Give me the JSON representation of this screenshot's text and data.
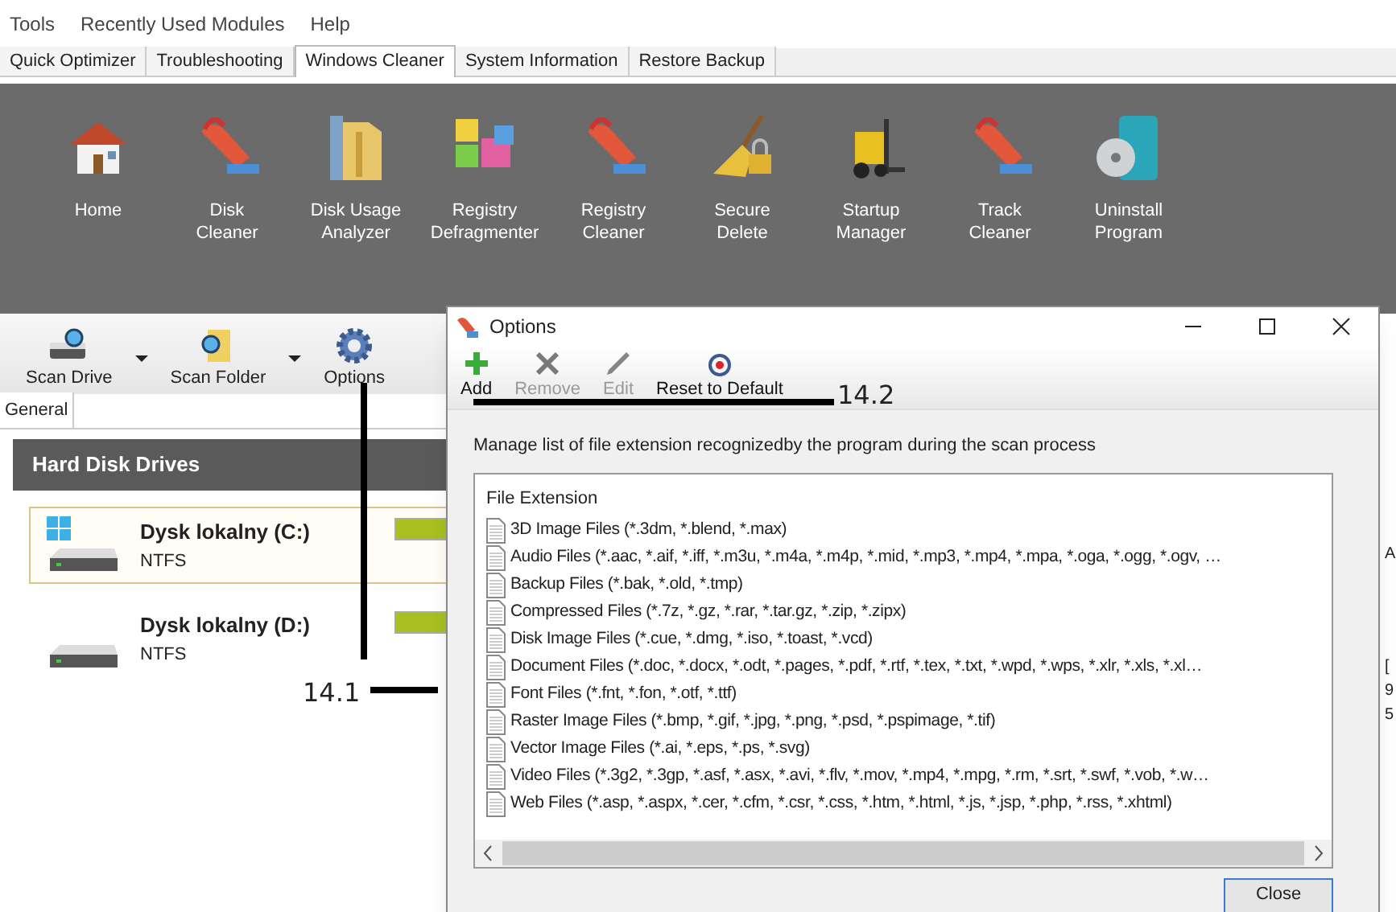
{
  "menu": [
    "Tools",
    "Recently Used Modules",
    "Help"
  ],
  "tabs": [
    {
      "label": "Quick Optimizer",
      "selected": false
    },
    {
      "label": "Troubleshooting",
      "selected": false
    },
    {
      "label": "Windows Cleaner",
      "selected": true
    },
    {
      "label": "System Information",
      "selected": false
    },
    {
      "label": "Restore Backup",
      "selected": false
    }
  ],
  "modules": [
    {
      "label": "Home",
      "kind": "house"
    },
    {
      "label": "Disk\nCleaner",
      "kind": "vacuum"
    },
    {
      "label": "Disk Usage\nAnalyzer",
      "kind": "folder"
    },
    {
      "label": "Registry\nDefragmenter",
      "kind": "blocks"
    },
    {
      "label": "Registry\nCleaner",
      "kind": "vacuum"
    },
    {
      "label": "Secure\nDelete",
      "kind": "broom"
    },
    {
      "label": "Startup\nManager",
      "kind": "forklift"
    },
    {
      "label": "Track\nCleaner",
      "kind": "vacuum"
    },
    {
      "label": "Uninstall\nProgram",
      "kind": "disc"
    }
  ],
  "toolbar": [
    {
      "label": "Scan Drive",
      "kind": "drive",
      "dropdown": true
    },
    {
      "label": "Scan Folder",
      "kind": "folder",
      "dropdown": true
    },
    {
      "label": "Options",
      "kind": "gear",
      "dropdown": false
    }
  ],
  "panel_tab": "General",
  "section_title": "Hard Disk Drives",
  "drives": [
    {
      "name": "Dysk lokalny (C:)",
      "fs": "NTFS",
      "system": true,
      "selected": true
    },
    {
      "name": "Dysk lokalny (D:)",
      "fs": "NTFS",
      "system": false,
      "selected": false
    }
  ],
  "background_fragments": [
    "A",
    "[",
    "9",
    "5"
  ],
  "dialog": {
    "title": "Options",
    "toolbar": [
      {
        "label": "Add",
        "kind": "add",
        "disabled": false
      },
      {
        "label": "Remove",
        "kind": "remove",
        "disabled": true
      },
      {
        "label": "Edit",
        "kind": "edit",
        "disabled": true
      },
      {
        "label": "Reset to Default",
        "kind": "reset",
        "disabled": false
      }
    ],
    "description": "Manage list of file extension recognizedby the program during the scan process",
    "list_header": "File Extension",
    "items": [
      "3D Image Files (*.3dm, *.blend, *.max)",
      "Audio Files (*.aac, *.aif, *.iff, *.m3u, *.m4a, *.m4p, *.mid, *.mp3, *.mp4, *.mpa, *.oga, *.ogg, *.ogv, …",
      "Backup Files (*.bak, *.old, *.tmp)",
      "Compressed Files (*.7z, *.gz, *.rar, *.tar.gz, *.zip, *.zipx)",
      "Disk Image Files (*.cue, *.dmg, *.iso, *.toast, *.vcd)",
      "Document Files (*.doc, *.docx, *.odt, *.pages, *.pdf, *.rtf, *.tex, *.txt, *.wpd, *.wps, *.xlr, *.xls, *.xl…",
      "Font Files (*.fnt, *.fon, *.otf, *.ttf)",
      "Raster Image Files (*.bmp, *.gif, *.jpg, *.png, *.psd, *.pspimage, *.tif)",
      "Vector Image Files (*.ai, *.eps, *.ps, *.svg)",
      "Video Files (*.3g2, *.3gp, *.asf, *.asx, *.avi, *.flv, *.mov, *.mp4, *.mpg, *.rm, *.srt, *.swf, *.vob, *.w…",
      "Web Files (*.asp, *.aspx, *.cer, *.cfm, *.csr, *.css, *.htm, *.html, *.js, *.jsp, *.php, *.rss, *.xhtml)"
    ],
    "close_button": "Close"
  },
  "annotations": [
    "14.1",
    "14.2"
  ]
}
